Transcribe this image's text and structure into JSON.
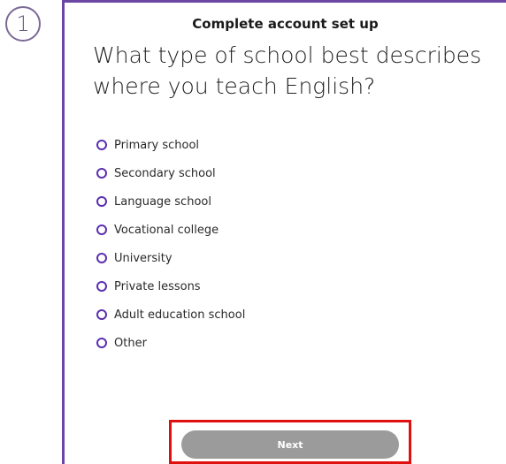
{
  "step": {
    "number": "1"
  },
  "header": {
    "title": "Complete account set up"
  },
  "question": {
    "text": "What type of school best describes where you teach English?"
  },
  "options": [
    {
      "label": "Primary school",
      "selected": false
    },
    {
      "label": "Secondary school",
      "selected": false
    },
    {
      "label": "Language school",
      "selected": false
    },
    {
      "label": "Vocational college",
      "selected": false
    },
    {
      "label": "University",
      "selected": false
    },
    {
      "label": "Private lessons",
      "selected": false
    },
    {
      "label": "Adult education school",
      "selected": false
    },
    {
      "label": "Other",
      "selected": false
    }
  ],
  "footer": {
    "next_label": "Next"
  },
  "colors": {
    "accent": "#6b46a3",
    "radio": "#5b2fb0",
    "button_disabled": "#9b9b9b",
    "highlight": "#e01010"
  }
}
